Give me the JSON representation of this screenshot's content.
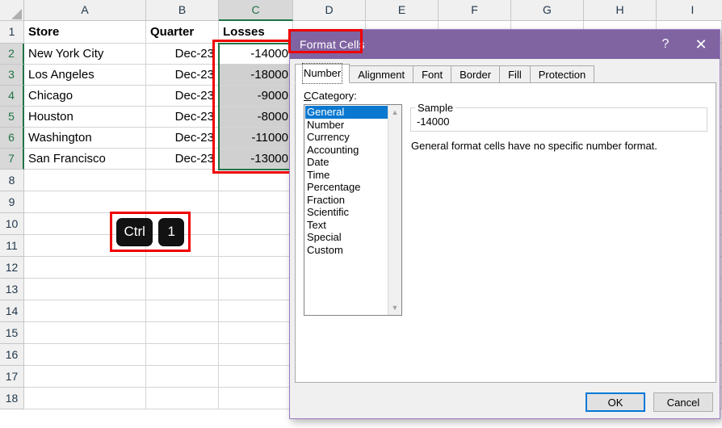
{
  "spreadsheet": {
    "column_headers": [
      "A",
      "B",
      "C",
      "D",
      "E",
      "F",
      "G",
      "H",
      "I"
    ],
    "row_headers": [
      "1",
      "2",
      "3",
      "4",
      "5",
      "6",
      "7",
      "8",
      "9",
      "10",
      "11",
      "12",
      "13",
      "14",
      "15",
      "16",
      "17",
      "18"
    ],
    "selected_column": "C",
    "selected_rows": [
      "2",
      "3",
      "4",
      "5",
      "6",
      "7"
    ],
    "active_cell": "C2",
    "selection_range": "C2:C7",
    "headers": [
      "Store",
      "Quarter",
      "Losses"
    ],
    "rows": [
      {
        "store": "New York City",
        "quarter": "Dec-23",
        "losses": "-14000"
      },
      {
        "store": "Los Angeles",
        "quarter": "Dec-23",
        "losses": "-18000"
      },
      {
        "store": "Chicago",
        "quarter": "Dec-23",
        "losses": "-9000"
      },
      {
        "store": "Houston",
        "quarter": "Dec-23",
        "losses": "-8000"
      },
      {
        "store": "Washington",
        "quarter": "Dec-23",
        "losses": "-11000"
      },
      {
        "store": "San Francisco",
        "quarter": "Dec-23",
        "losses": "-13000"
      }
    ]
  },
  "shortcut_badge": {
    "keys": [
      "Ctrl",
      "1"
    ]
  },
  "dialog": {
    "title": "Format Cells",
    "help_icon": "question-mark-icon",
    "close_icon": "close-icon",
    "tabs": [
      {
        "label": "Number",
        "active": true
      },
      {
        "label": "Alignment",
        "active": false
      },
      {
        "label": "Font",
        "active": false
      },
      {
        "label": "Border",
        "active": false
      },
      {
        "label": "Fill",
        "active": false
      },
      {
        "label": "Protection",
        "active": false
      }
    ],
    "category_label": "Category:",
    "categories": [
      "General",
      "Number",
      "Currency",
      "Accounting",
      "Date",
      "Time",
      "Percentage",
      "Fraction",
      "Scientific",
      "Text",
      "Special",
      "Custom"
    ],
    "selected_category": "General",
    "sample_legend": "Sample",
    "sample_value": "-14000",
    "description": "General format cells have no specific number format.",
    "buttons": {
      "ok": "OK",
      "cancel": "Cancel"
    }
  },
  "colors": {
    "dialog_title_bar": "#8064a2",
    "highlight_box": "#ef0000",
    "list_selection": "#0b78d0",
    "excel_green": "#217346",
    "default_button_border": "#0078d7"
  }
}
